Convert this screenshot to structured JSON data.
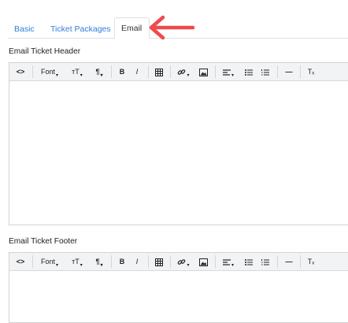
{
  "tabs": [
    {
      "label": "Basic",
      "active": false
    },
    {
      "label": "Ticket Packages",
      "active": false
    },
    {
      "label": "Email",
      "active": true
    }
  ],
  "accent_color": "#2f7fd8",
  "arrow_color": "#f04a4a",
  "header_section": {
    "label": "Email Ticket Header"
  },
  "footer_section": {
    "label": "Email Ticket Footer"
  },
  "toolbar": {
    "code": "<>",
    "font": "Font",
    "font_caret": "⌄",
    "text_size": "ᴛT",
    "paragraph": "¶",
    "bold": "B",
    "italic": "I",
    "table_icon": "table-icon",
    "link_icon": "link-icon",
    "image_icon": "image-icon",
    "align_icon": "align-left-icon",
    "unordered_list_icon": "bullet-list-icon",
    "ordered_list_icon": "numbered-list-icon",
    "hr": "—",
    "clear_format": "Tₓ"
  }
}
